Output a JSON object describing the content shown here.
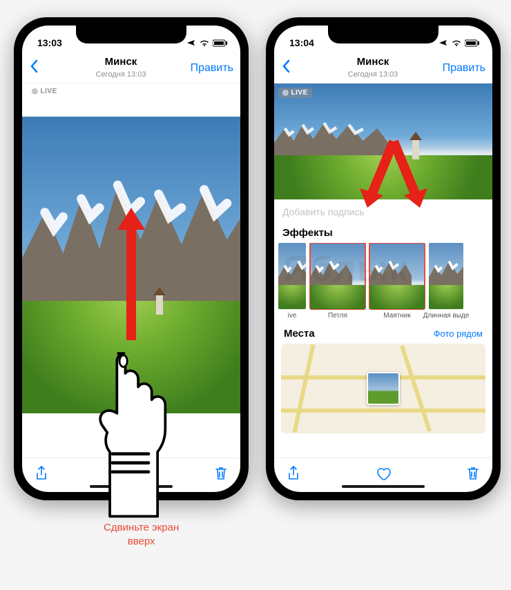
{
  "watermark": "Яблык",
  "instruction_line1": "Сдвиньте экран",
  "instruction_line2": "вверх",
  "left": {
    "time": "13:03",
    "nav": {
      "title": "Минск",
      "subtitle": "Сегодня 13:03",
      "edit": "Править"
    },
    "live_badge": "LIVE"
  },
  "right": {
    "time": "13:04",
    "nav": {
      "title": "Минск",
      "subtitle": "Сегодня 13:03",
      "edit": "Править"
    },
    "live_badge": "LIVE",
    "caption_placeholder": "Добавить подпись",
    "effects_title": "Эффекты",
    "effects": [
      {
        "label": "ive"
      },
      {
        "label": "Петля"
      },
      {
        "label": "Маятник"
      },
      {
        "label": "Длинная выде"
      }
    ],
    "places": {
      "title": "Места",
      "link": "Фото рядом"
    }
  },
  "colors": {
    "accent": "#007aff",
    "highlight": "#e74c3c"
  }
}
